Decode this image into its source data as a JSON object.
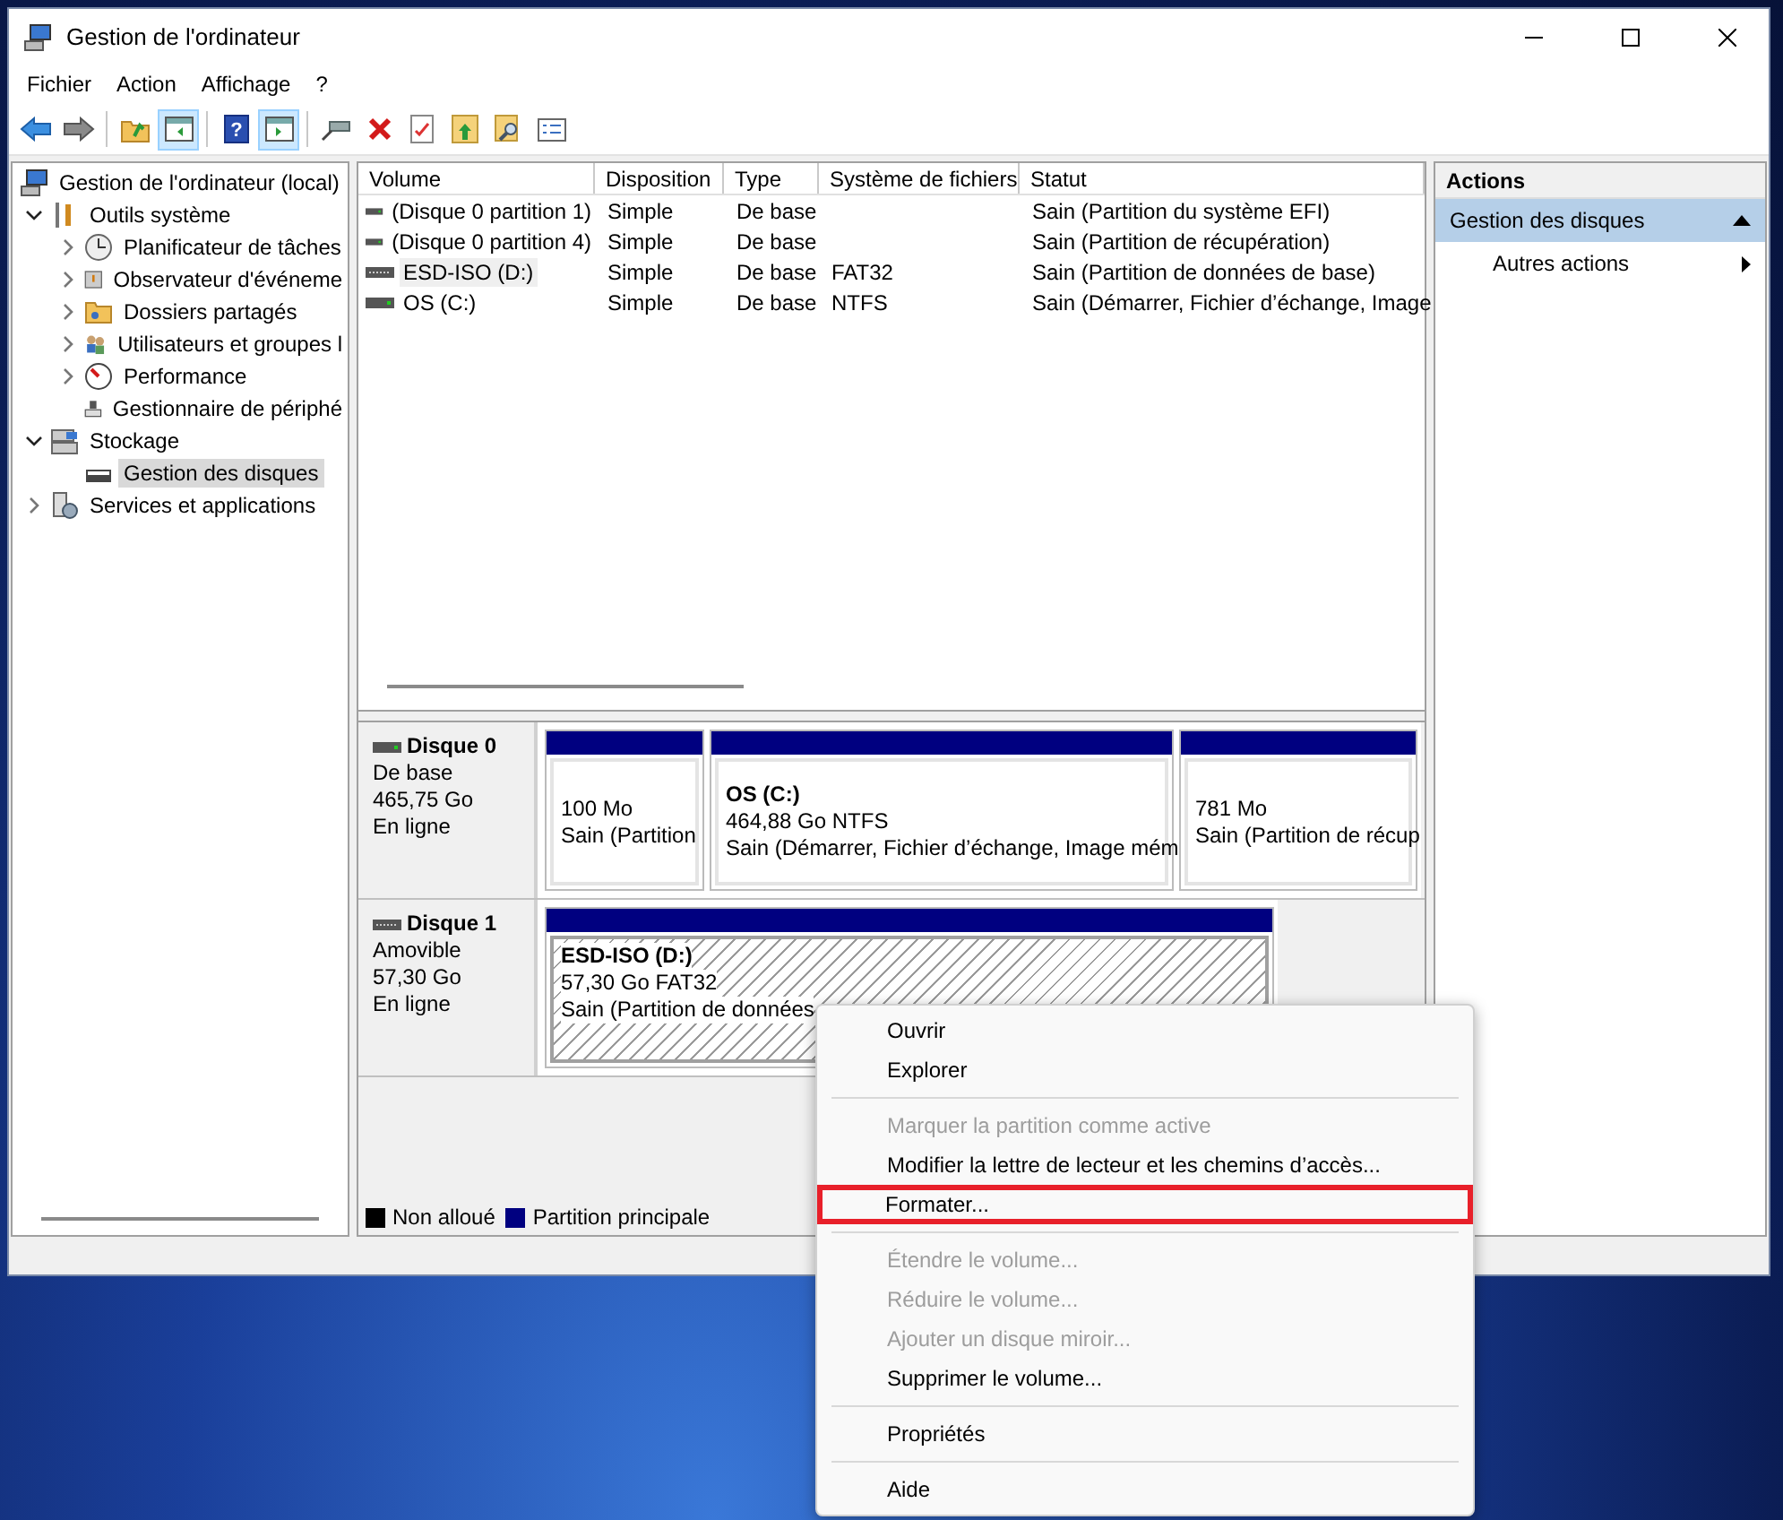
{
  "window": {
    "title": "Gestion de l'ordinateur"
  },
  "menu_bar": [
    "Fichier",
    "Action",
    "Affichage",
    "?"
  ],
  "toolbar": [
    {
      "kind": "back",
      "pressed": false
    },
    {
      "kind": "forward",
      "pressed": false
    },
    {
      "kind": "separator"
    },
    {
      "kind": "folder-up",
      "pressed": false
    },
    {
      "kind": "pane-left",
      "pressed": true
    },
    {
      "kind": "separator"
    },
    {
      "kind": "help",
      "label": "?",
      "pressed": false
    },
    {
      "kind": "pane-right",
      "pressed": true
    },
    {
      "kind": "separator"
    },
    {
      "kind": "connect",
      "pressed": false
    },
    {
      "kind": "delete",
      "pressed": false
    },
    {
      "kind": "check",
      "pressed": false
    },
    {
      "kind": "folder-arrow",
      "pressed": false
    },
    {
      "kind": "folder-search",
      "pressed": false
    },
    {
      "kind": "list",
      "pressed": false
    }
  ],
  "tree": [
    {
      "label": "Gestion de l'ordinateur (local)",
      "kind": "computer",
      "selected": false,
      "children": [
        {
          "label": "Outils système",
          "kind": "tools",
          "expanded": true,
          "selected": false,
          "children": [
            {
              "label": "Planificateur de tâches",
              "kind": "clock",
              "expanded": false,
              "selected": false
            },
            {
              "label": "Observateur d'événeme",
              "kind": "events",
              "expanded": false,
              "selected": false
            },
            {
              "label": "Dossiers partagés",
              "kind": "folder",
              "expanded": false,
              "selected": false
            },
            {
              "label": "Utilisateurs et groupes l",
              "kind": "users",
              "expanded": false,
              "selected": false
            },
            {
              "label": "Performance",
              "kind": "performance",
              "expanded": false,
              "selected": false
            },
            {
              "label": "Gestionnaire de périphé",
              "kind": "devices",
              "selected": false
            }
          ]
        },
        {
          "label": "Stockage",
          "kind": "storage",
          "expanded": true,
          "selected": false,
          "children": [
            {
              "label": "Gestion des disques",
              "kind": "disk",
              "selected": true
            }
          ]
        },
        {
          "label": "Services et applications",
          "kind": "services",
          "expanded": false,
          "selected": false
        }
      ]
    }
  ],
  "volume_table": {
    "columns": [
      "Volume",
      "Disposition",
      "Type",
      "Système de fichiers",
      "Statut"
    ],
    "rows": [
      {
        "cells": [
          "(Disque 0 partition 1)",
          "Simple",
          "De base",
          "",
          "Sain (Partition du système EFI)"
        ],
        "selected": false
      },
      {
        "cells": [
          "(Disque 0 partition 4)",
          "Simple",
          "De base",
          "",
          "Sain (Partition de récupération)"
        ],
        "selected": false
      },
      {
        "cells": [
          "ESD-ISO (D:)",
          "Simple",
          "De base",
          "FAT32",
          "Sain (Partition de données de base)"
        ],
        "selected": true
      },
      {
        "cells": [
          "OS (C:)",
          "Simple",
          "De base",
          "NTFS",
          "Sain (Démarrer, Fichier d’échange, Image"
        ],
        "selected": false
      }
    ]
  },
  "disks": [
    {
      "name": "Disque 0",
      "type": "De base",
      "size": "465,75 Go",
      "state": "En ligne",
      "partitions": [
        {
          "size": "100 Mo",
          "status": "Sain (Partition",
          "selected": false
        },
        {
          "title": "OS  (C:)",
          "size": "464,88 Go NTFS",
          "status": "Sain (Démarrer, Fichier d’échange, Image mém",
          "selected": false
        },
        {
          "size": "781 Mo",
          "status": "Sain (Partition de récup",
          "selected": false
        }
      ]
    },
    {
      "name": "Disque 1",
      "type": "Amovible",
      "size": "57,30 Go",
      "state": "En ligne",
      "partitions": [
        {
          "title": "ESD-ISO  (D:)",
          "size": "57,30 Go FAT32",
          "status": "Sain (Partition de données",
          "selected": true
        }
      ]
    }
  ],
  "legend": [
    {
      "label": "Non alloué",
      "color": "#000000"
    },
    {
      "label": "Partition principale",
      "color": "#000080"
    }
  ],
  "actions": {
    "title": "Actions",
    "section": {
      "label": "Gestion des disques",
      "expanded": true
    },
    "items": [
      {
        "label": "Autres actions"
      }
    ]
  },
  "context_menu": [
    {
      "kind": "item",
      "label": "Ouvrir",
      "disabled": false,
      "highlighted": false
    },
    {
      "kind": "item",
      "label": "Explorer",
      "disabled": false,
      "highlighted": false
    },
    {
      "kind": "separator"
    },
    {
      "kind": "item",
      "label": "Marquer la partition comme active",
      "disabled": true,
      "highlighted": false
    },
    {
      "kind": "item",
      "label": "Modifier la lettre de lecteur et les chemins d’accès...",
      "disabled": false,
      "highlighted": false
    },
    {
      "kind": "item",
      "label": "Formater...",
      "disabled": false,
      "highlighted": true
    },
    {
      "kind": "separator"
    },
    {
      "kind": "item",
      "label": "Étendre le volume...",
      "disabled": true,
      "highlighted": false
    },
    {
      "kind": "item",
      "label": "Réduire le volume...",
      "disabled": true,
      "highlighted": false
    },
    {
      "kind": "item",
      "label": "Ajouter un disque miroir...",
      "disabled": true,
      "highlighted": false
    },
    {
      "kind": "item",
      "label": "Supprimer le volume...",
      "disabled": false,
      "highlighted": false
    },
    {
      "kind": "separator"
    },
    {
      "kind": "item",
      "label": "Propriétés",
      "disabled": false,
      "highlighted": false
    },
    {
      "kind": "separator"
    },
    {
      "kind": "item",
      "label": "Aide",
      "disabled": false,
      "highlighted": false
    }
  ]
}
